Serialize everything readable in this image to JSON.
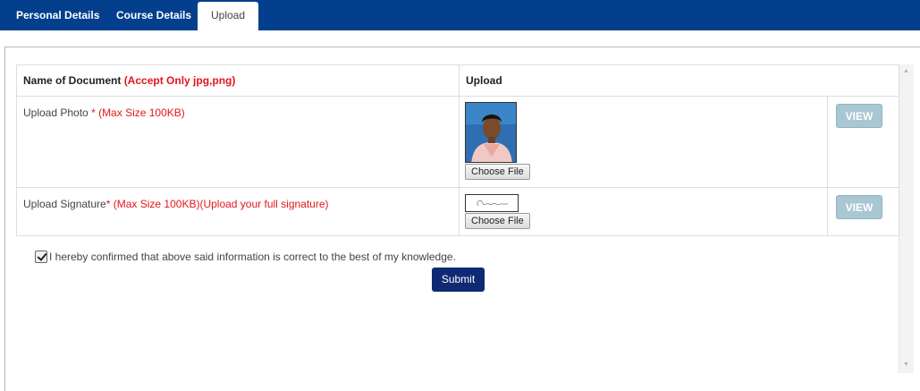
{
  "tabs": [
    {
      "label": "Personal Details",
      "active": false
    },
    {
      "label": "Course Details",
      "active": false
    },
    {
      "label": "Upload",
      "active": true
    }
  ],
  "table": {
    "header_document": "Name of Document ",
    "header_accept": "(Accept Only jpg,png)",
    "header_upload": "Upload",
    "rows": [
      {
        "label": "Upload Photo ",
        "required": "*",
        "note": " (Max Size 100KB)",
        "file_button": "Choose File",
        "view_button": "VIEW"
      },
      {
        "label": "Upload Signature",
        "required": "*",
        "note": " (Max Size 100KB)(Upload your full signature)",
        "file_button": "Choose File",
        "view_button": "VIEW"
      }
    ]
  },
  "confirm_text": "I hereby confirmed that above said information is correct to the best of my knowledge.",
  "confirm_checked": true,
  "submit_label": "Submit",
  "colors": {
    "tabbar": "#043f8d",
    "required_text": "#e3161b",
    "view_button": "#a9c7d2",
    "submit_button": "#0f2a72"
  },
  "icons": [
    "checkmark-icon",
    "scroll-up-arrow-icon",
    "scroll-down-arrow-icon"
  ]
}
